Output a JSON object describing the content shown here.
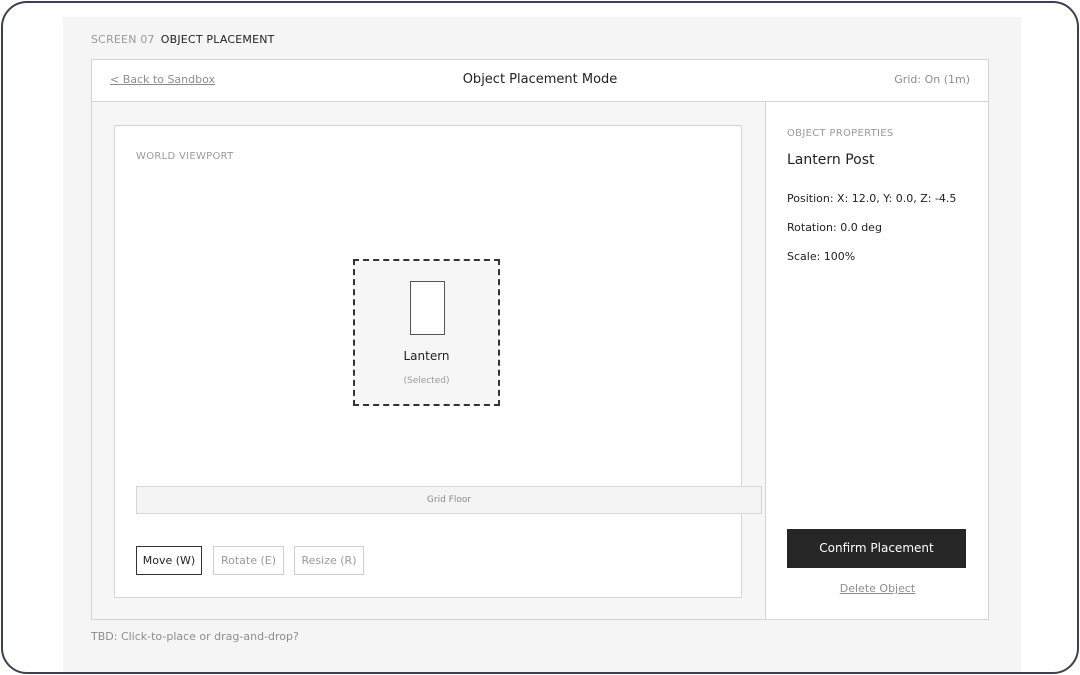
{
  "screen": {
    "number": "SCREEN 07",
    "name": "OBJECT PLACEMENT"
  },
  "header": {
    "back_label": "< Back to Sandbox",
    "title": "Object Placement Mode",
    "grid_status": "Grid: On (1m)"
  },
  "viewport": {
    "label": "WORLD VIEWPORT",
    "object": {
      "name": "Lantern",
      "state": "(Selected)"
    },
    "floor_label": "Grid Floor"
  },
  "tools": [
    {
      "label": "Move (W)",
      "active": true
    },
    {
      "label": "Rotate (E)",
      "active": false
    },
    {
      "label": "Resize (R)",
      "active": false
    }
  ],
  "properties": {
    "section_label": "OBJECT PROPERTIES",
    "title": "Lantern Post",
    "position": "Position: X: 12.0, Y: 0.0, Z: -4.5",
    "rotation": "Rotation: 0.0 deg",
    "scale": "Scale: 100%"
  },
  "actions": {
    "confirm_label": "Confirm Placement",
    "delete_label": "Delete Object"
  },
  "footer_note": "TBD: Click-to-place or drag-and-drop?",
  "colors": {
    "primary_button": "#262626",
    "border": "#d4d4d4",
    "muted_text": "#8d8d8d"
  }
}
